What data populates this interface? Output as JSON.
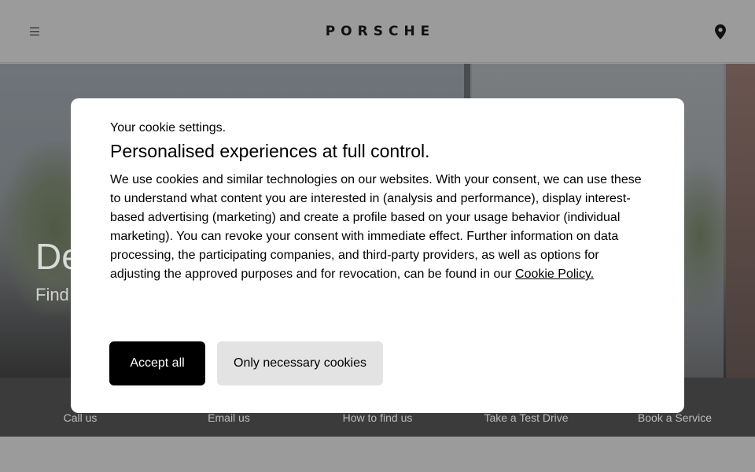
{
  "header": {
    "logo_text": "PORSCHE",
    "menu_icon": "hamburger-icon",
    "location_icon": "map-pin-icon"
  },
  "hero": {
    "title": "De",
    "subtitle": "Find"
  },
  "quicklinks": [
    {
      "label": "Call us"
    },
    {
      "label": "Email us"
    },
    {
      "label": "How to find us"
    },
    {
      "label": "Take a Test Drive"
    },
    {
      "label": "Book a Service"
    }
  ],
  "cookie_modal": {
    "kicker": "Your cookie settings.",
    "title": "Personalised experiences at full control.",
    "body": "We use cookies and similar technologies on our websites. With your consent, we can use these to understand what content you are interested in (analysis and performance), display interest-based advertising (marketing) and create a profile based on your usage behavior (individual marketing). You can revoke your consent with immediate effect. Further information on data processing, the participating companies, and third-party providers, as well as options for adjusting the approved purposes and for revocation, can be found in our ",
    "policy_link": "Cookie Policy.",
    "accept_label": "Accept all",
    "necessary_label": "Only necessary cookies"
  },
  "colors": {
    "accept_bg": "#000000",
    "necessary_bg": "#e3e3e3",
    "overlay": "#9b9b9b"
  }
}
